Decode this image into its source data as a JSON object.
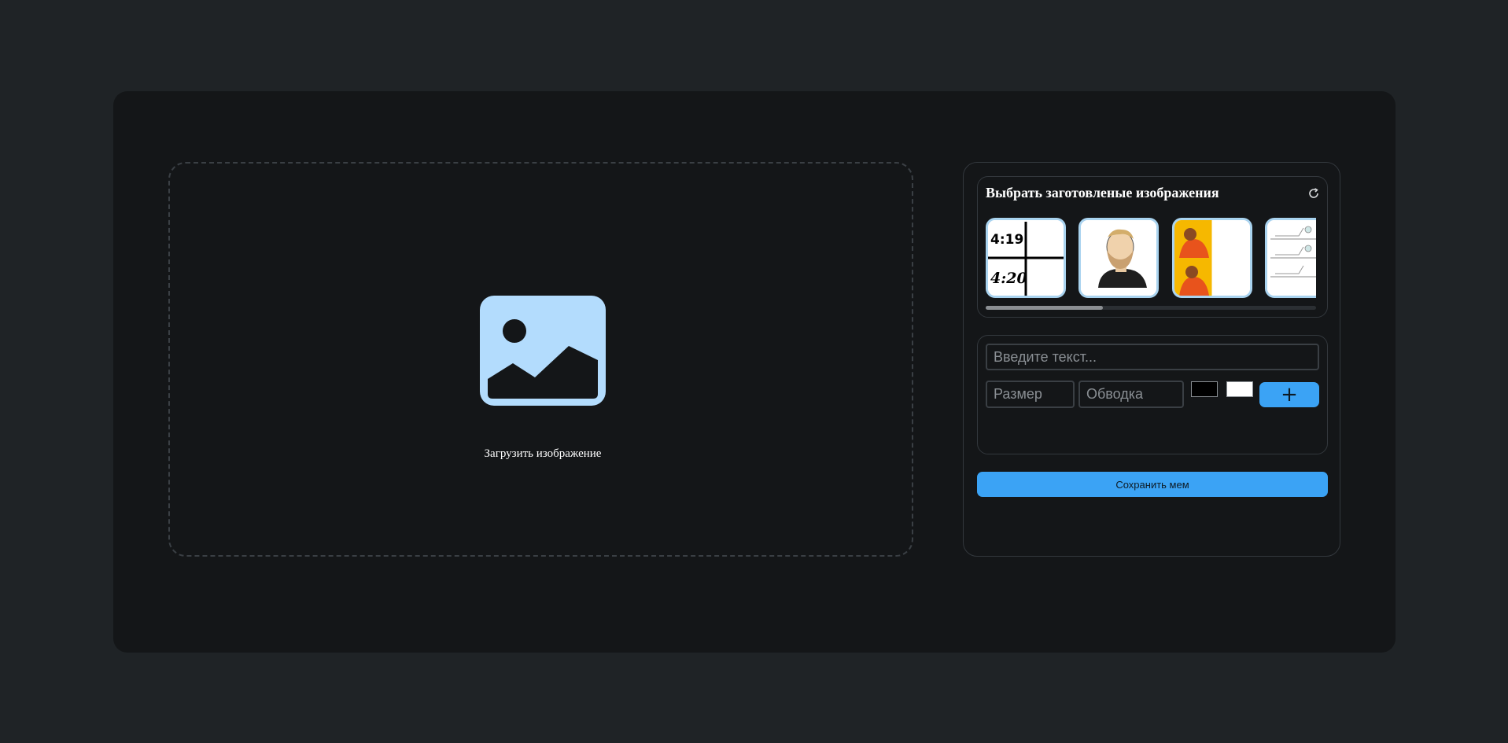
{
  "upload": {
    "label": "Загрузить изображение",
    "icon": "image-upload-icon",
    "icon_color": "#b3dcfd"
  },
  "templates": {
    "title": "Выбрать заготовленые изображения",
    "refresh_icon": "refresh-icon",
    "items": [
      {
        "name": "template-419-420",
        "top_text": "4:19",
        "bottom_text": "4:20"
      },
      {
        "name": "template-yes-chad"
      },
      {
        "name": "template-drake"
      },
      {
        "name": "template-comic-panels"
      }
    ],
    "scroll_position": 0.0
  },
  "text_editor": {
    "text_placeholder": "Введите текст...",
    "size_placeholder": "Размер",
    "stroke_placeholder": "Обводка",
    "fill_color": "#000000",
    "stroke_color": "#ffffff",
    "add_label": "+"
  },
  "save_label": "Сохранить мем",
  "colors": {
    "background": "#1f2326",
    "card": "#141618",
    "accent": "#3ba3f5"
  }
}
